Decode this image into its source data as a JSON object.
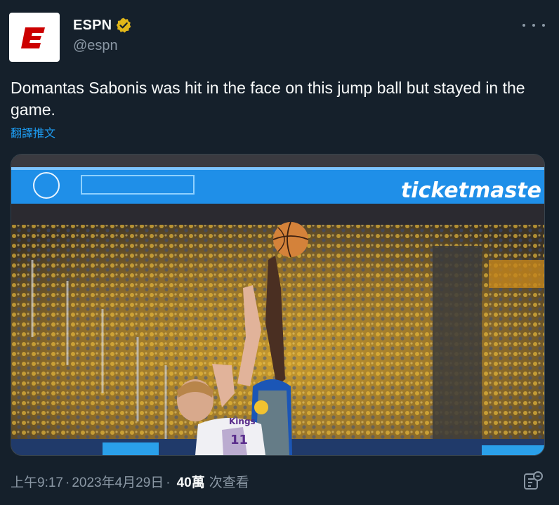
{
  "author": {
    "display_name": "ESPN",
    "handle": "@espn",
    "avatar_icon": "espn-logo",
    "verified_icon": "verified-gold-badge",
    "brand_color": "#cc0000",
    "verified_color": "#e2b719"
  },
  "more_icon": "more-horizontal-icon",
  "tweet": {
    "text": "Domantas Sabonis was hit in the face on this jump ball but stayed in the game.",
    "translate_label": "翻譯推文"
  },
  "media": {
    "type": "video-frame",
    "banner_text": "ticketmaste",
    "jersey_front": "Kings",
    "jersey_number": "11"
  },
  "meta": {
    "time": "上午9:17",
    "separator": "·",
    "date": "2023年4月29日",
    "views_count": "40萬",
    "views_label": "次查看"
  },
  "stats_icon": "view-analytics-icon",
  "colors": {
    "background": "#15202b",
    "text_primary": "#f7f9f9",
    "text_secondary": "#8b98a5",
    "link": "#1d9bf0",
    "border": "#38444d"
  }
}
